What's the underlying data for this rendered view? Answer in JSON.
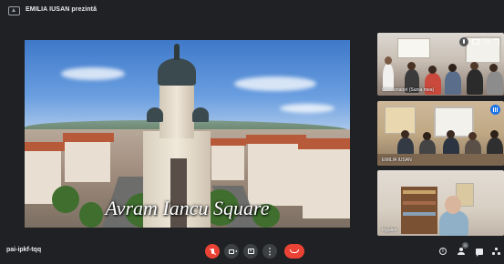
{
  "header": {
    "presenting_text": "EMILIA IUSAN prezintă",
    "present_icon": "present-to-all-icon"
  },
  "presentation": {
    "caption": "Avram Iancu Square"
  },
  "tiles": [
    {
      "name": "Consumatori (Sursa mea)",
      "controls": {
        "label": "Tu",
        "icons": [
          "mic-off-icon",
          "camera-icon",
          "expand-icon"
        ]
      }
    },
    {
      "name": "EMILIA IUSAN",
      "badge_icon": "speaking-indicator-icon"
    },
    {
      "name": "Ingalen"
    }
  ],
  "bottombar": {
    "meeting_code": "pai-ipkf-tqq",
    "participant_count": "9",
    "buttons": {
      "mic": "mic-off-icon",
      "camera": "camera-icon",
      "present": "present-icon",
      "more": "more-options-icon",
      "hangup": "hang-up-icon"
    },
    "right_icons": [
      "info-icon",
      "people-icon",
      "chat-icon",
      "activities-icon"
    ]
  },
  "colors": {
    "background": "#202124",
    "control": "#3c4043",
    "danger": "#ea4335",
    "accent": "#1a73e8",
    "text": "#e8eaed"
  }
}
